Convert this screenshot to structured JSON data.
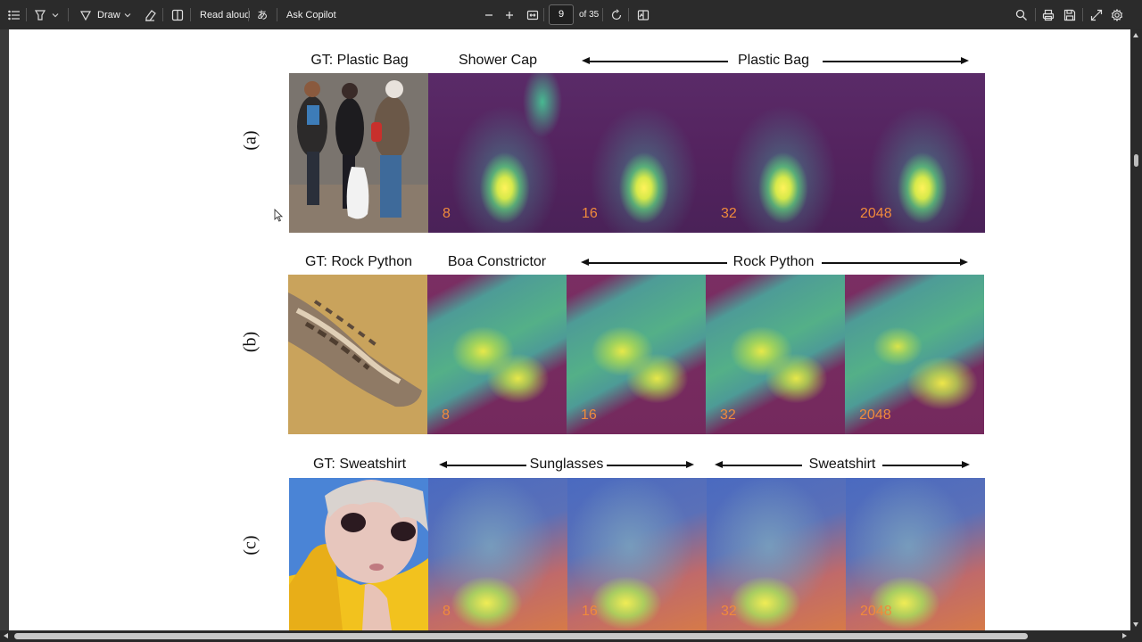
{
  "toolbar": {
    "draw_label": "Draw",
    "read_aloud_label": "Read aloud",
    "translate_label": "あ",
    "ask_copilot_label": "Ask Copilot",
    "page_number": "9",
    "page_total": "of 35"
  },
  "figure": {
    "rows": [
      {
        "tag": "(a)",
        "gt_label": "GT: Plastic Bag",
        "first_label": "Shower Cap",
        "span_label": "Plastic Bag",
        "numbers": [
          "8",
          "16",
          "32",
          "2048"
        ]
      },
      {
        "tag": "(b)",
        "gt_label": "GT: Rock Python",
        "first_label": "Boa Constrictor",
        "span_label": "Rock Python",
        "numbers": [
          "8",
          "16",
          "32",
          "2048"
        ]
      },
      {
        "tag": "(c)",
        "gt_label": "GT: Sweatshirt",
        "left_span_label": "Sunglasses",
        "right_span_label": "Sweatshirt",
        "numbers": [
          "8",
          "16",
          "32",
          "2048"
        ]
      }
    ]
  },
  "colors": {
    "toolbar_bg": "#2b2b2b",
    "viewer_bg": "#3b3b3b",
    "page_bg": "#ffffff",
    "number_label": "#f08a3c"
  }
}
